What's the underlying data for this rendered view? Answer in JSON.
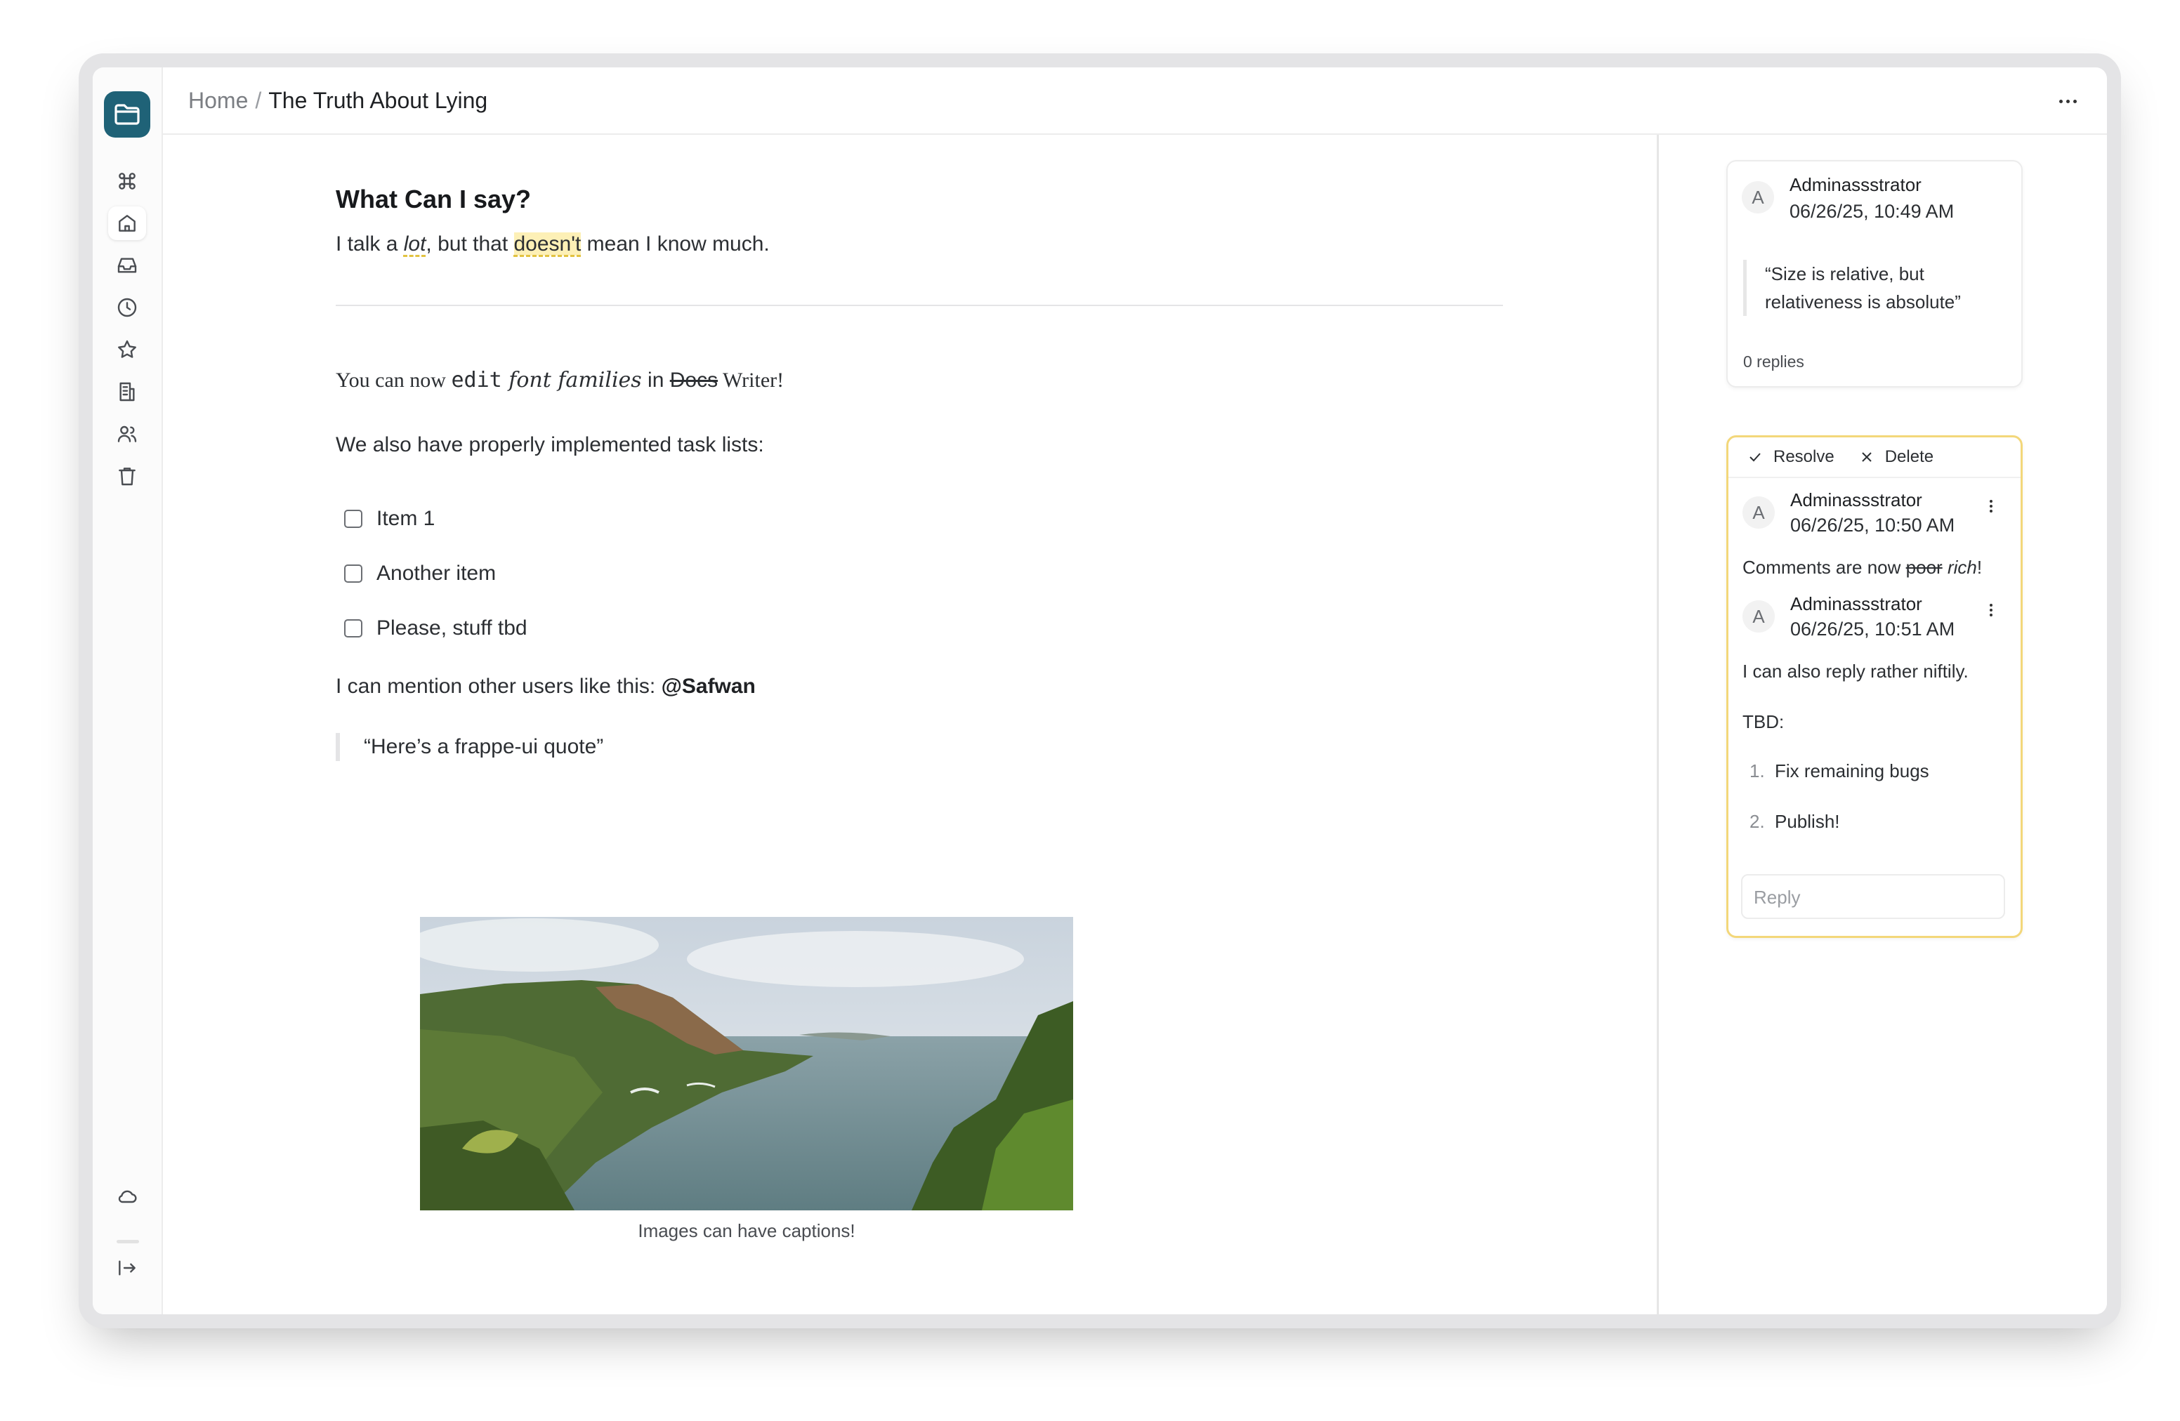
{
  "breadcrumb": {
    "home": "Home",
    "separator": "/",
    "page": "The Truth About Lying"
  },
  "sidebar": {
    "items": [
      {
        "icon": "command-icon"
      },
      {
        "icon": "home-icon"
      },
      {
        "icon": "inbox-icon"
      },
      {
        "icon": "clock-icon"
      },
      {
        "icon": "star-icon"
      },
      {
        "icon": "building-icon"
      },
      {
        "icon": "users-icon"
      },
      {
        "icon": "trash-icon"
      }
    ],
    "bottom": [
      {
        "icon": "cloud-icon"
      },
      {
        "icon": "logout-icon"
      }
    ]
  },
  "document": {
    "heading": "What Can I say?",
    "para1": {
      "a": "I talk a ",
      "b": "lot",
      "c": ", but that ",
      "d": "doesn't",
      "e": " mean I know much."
    },
    "fonts_line": {
      "a": "You can now ",
      "b": "edit",
      "c": " font families",
      "d": " in ",
      "e": "Docs",
      "f": " Writer!"
    },
    "tasks_intro": "We also have properly implemented task lists:",
    "tasks": [
      {
        "label": "Item 1",
        "checked": false
      },
      {
        "label": "Another item",
        "checked": false
      },
      {
        "label": "Please, stuff tbd",
        "checked": false
      }
    ],
    "mention_text": "I can mention other users like this: ",
    "mention": "@Safwan",
    "quote": "“Here’s a frappe-ui quote”",
    "image_caption": "Images can have captions!"
  },
  "comments": [
    {
      "avatar": "A",
      "author": "Adminassstrator",
      "date": "06/26/25, 10:49 AM",
      "quote": "“Size is relative, but relativeness is absolute”",
      "replies": "0 replies"
    },
    {
      "actions": {
        "resolve": "Resolve",
        "delete": "Delete"
      },
      "thread": [
        {
          "avatar": "A",
          "author": "Adminassstrator",
          "date": "06/26/25, 10:50 AM",
          "text_a": "Comments are now ",
          "text_b": "poor",
          "text_c": " ",
          "text_d": "rich",
          "text_e": "!"
        },
        {
          "avatar": "A",
          "author": "Adminassstrator",
          "date": "06/26/25, 10:51 AM",
          "text": "I can also reply rather niftily.",
          "tbd": "TBD:",
          "list": [
            {
              "num": "1.",
              "text": "Fix remaining bugs"
            },
            {
              "num": "2.",
              "text": "Publish!"
            }
          ]
        }
      ],
      "reply_placeholder": "Reply"
    }
  ],
  "colors": {
    "logo": "#1f6277",
    "highlight": "#fdf0b6",
    "active_comment_border": "#f3d77a"
  }
}
